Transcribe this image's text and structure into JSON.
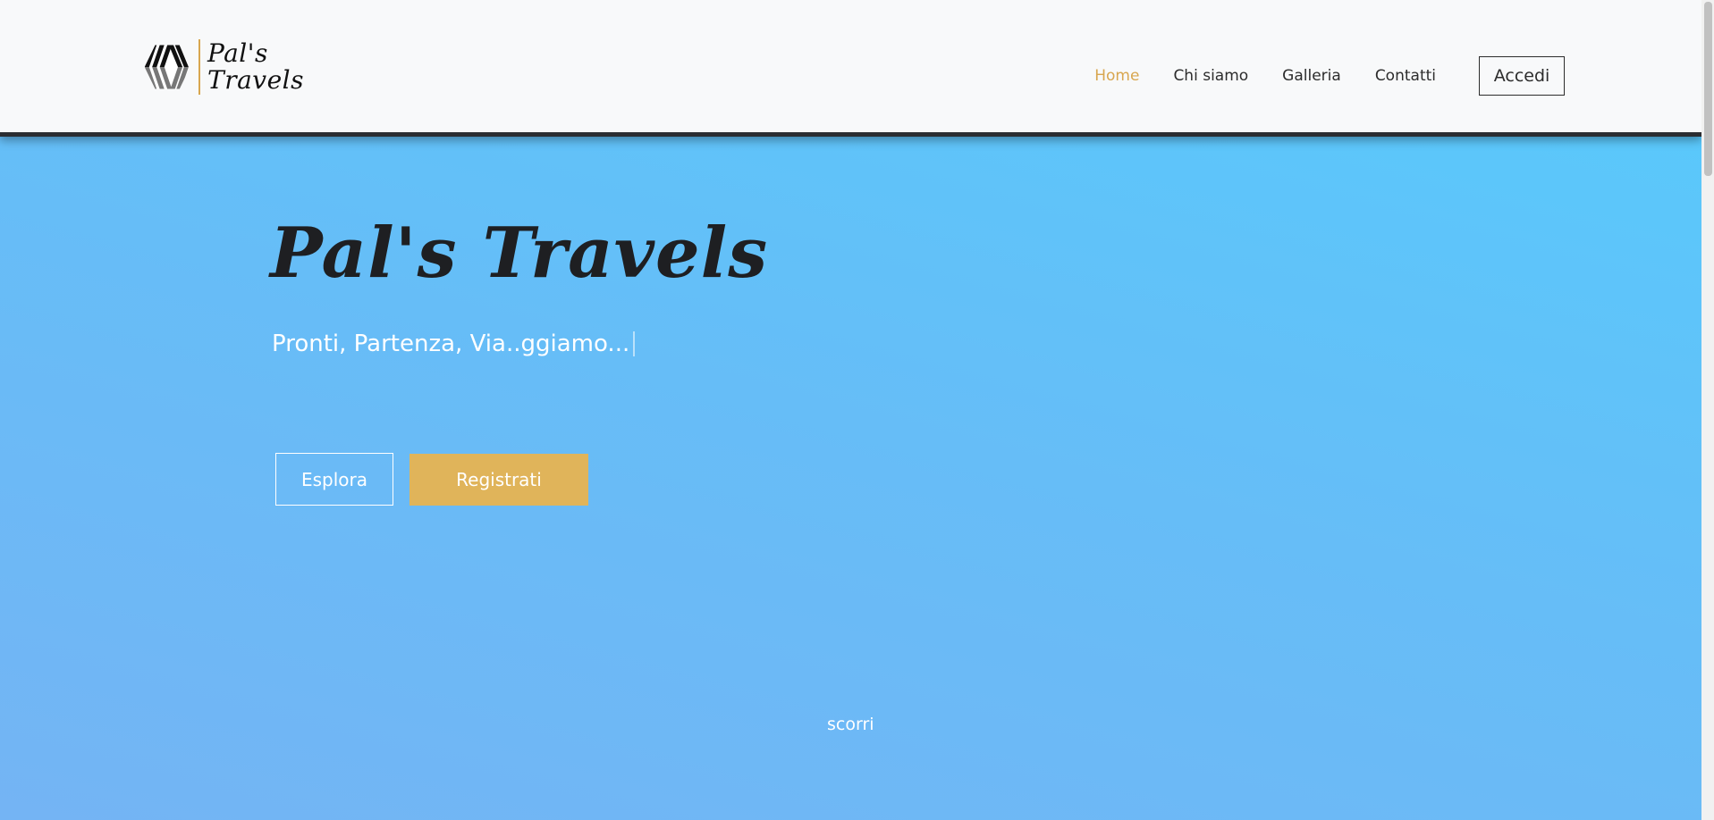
{
  "header": {
    "logo": {
      "line1": "Pal's",
      "line2": "Travels"
    },
    "nav": [
      {
        "label": "Home",
        "active": true
      },
      {
        "label": "Chi siamo",
        "active": false
      },
      {
        "label": "Galleria",
        "active": false
      },
      {
        "label": "Contatti",
        "active": false
      }
    ],
    "login_label": "Accedi"
  },
  "hero": {
    "title": "Pal's Travels",
    "subtitle": "Pronti, Partenza, Via..ggiamo...",
    "explore_label": "Esplora",
    "register_label": "Registrati",
    "scroll_label": "scorri"
  },
  "colors": {
    "accent": "#d8a64f",
    "register_button": "#e0b45a",
    "hero_gradient_start": "#5ac8fb",
    "hero_gradient_end": "#74b4f4",
    "header_bg": "#f8f9fa",
    "text_dark": "#2c2c2c"
  },
  "icons": {
    "logo_mark": "striped-hexagon-logo-icon"
  }
}
